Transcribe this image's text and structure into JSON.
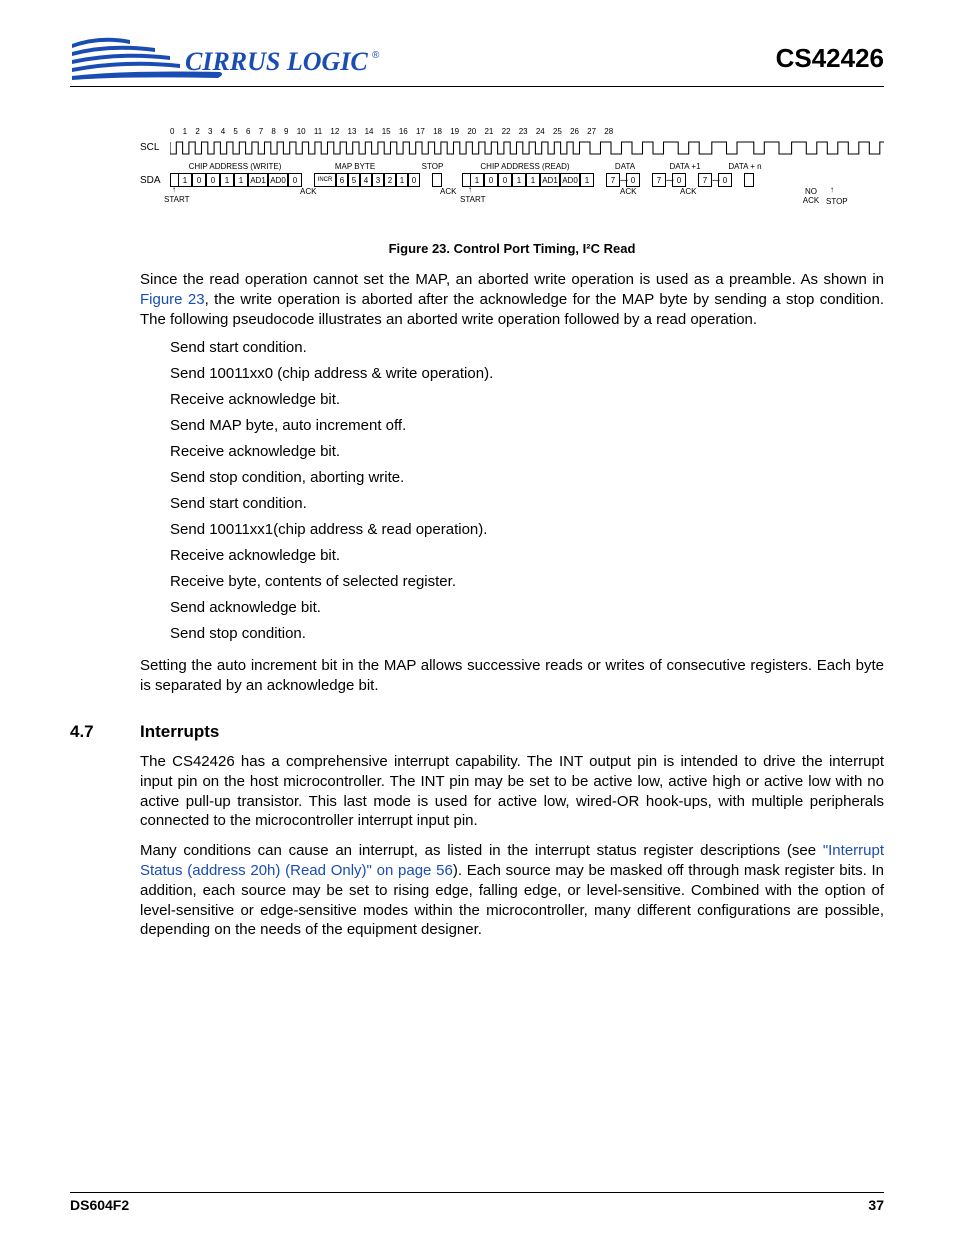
{
  "header": {
    "logo_text": "CIRRUS LOGIC",
    "part_number": "CS42426"
  },
  "figure": {
    "caption": "Figure 23.  Control Port Timing, I²C Read",
    "tick_numbers": "0  1  2  3  4  5  6  7  8  9  10 11 12 13 14 15 16 17 18  19  20 21 22 23 24 25 26 27 28",
    "scl_label": "SCL",
    "sda_label": "SDA",
    "top_labels": {
      "chip_addr_write": "CHIP ADDRESS (WRITE)",
      "map_byte": "MAP BYTE",
      "stop": "STOP",
      "chip_addr_read": "CHIP ADDRESS (READ)",
      "data": "DATA",
      "data_plus1": "DATA +1",
      "data_plusn": "DATA + n"
    },
    "sda_bits": {
      "addr_write": [
        "1",
        "0",
        "0",
        "1",
        "1",
        "AD1",
        "AD0",
        "0"
      ],
      "incr": "INCR",
      "map_bits": [
        "6",
        "5",
        "4",
        "3",
        "2",
        "1",
        "0"
      ],
      "addr_read": [
        "1",
        "0",
        "0",
        "1",
        "1",
        "AD1",
        "AD0",
        "1"
      ],
      "data_box": [
        "7",
        "0"
      ],
      "data1_box": [
        "7",
        "0"
      ],
      "datan_box": [
        "7",
        "0"
      ]
    },
    "bottom_labels": {
      "start1": "START",
      "ack1": "ACK",
      "ack2": "ACK",
      "start2": "START",
      "ack3": "ACK",
      "ack4": "ACK",
      "noack": "NO ACK",
      "stop2": "STOP"
    }
  },
  "para1_a": "Since the read operation cannot set the MAP, an aborted write operation is used as a preamble. As shown in ",
  "para1_link": "Figure 23",
  "para1_b": ", the write operation is aborted after the acknowledge for the MAP byte by sending a stop condition. The following pseudocode illustrates an aborted write operation followed by a read operation.",
  "pseudo": [
    "Send start condition.",
    "Send 10011xx0 (chip address & write operation).",
    "Receive acknowledge bit.",
    "Send MAP byte, auto increment off.",
    "Receive acknowledge bit.",
    "Send stop condition, aborting write.",
    "Send start condition.",
    "Send 10011xx1(chip address & read operation).",
    "Receive acknowledge bit.",
    "Receive byte, contents of selected register.",
    "Send acknowledge bit.",
    "Send stop condition."
  ],
  "para2": "Setting the auto increment bit in the MAP allows successive reads or writes of consecutive registers. Each byte is separated by an acknowledge bit.",
  "section": {
    "num": "4.7",
    "title": "Interrupts"
  },
  "para3": "The CS42426 has a comprehensive interrupt capability. The INT output pin is intended to drive the interrupt input pin on the host microcontroller. The INT pin may be set to be active low, active high or active low with no active pull-up transistor. This last mode is used for active low, wired-OR hook-ups, with multiple peripherals connected to the microcontroller interrupt input pin.",
  "para4_a": "Many conditions can cause an interrupt, as listed in the interrupt status register descriptions (see ",
  "para4_link": "\"Interrupt Status (address 20h) (Read Only)\" on page 56",
  "para4_b": "). Each source may be masked off through mask register bits. In addition, each source may be set to rising edge, falling edge, or level-sensitive. Combined with the option of level-sensitive or edge-sensitive modes within the microcontroller, many different configurations are possible, depending on the needs of the equipment designer.",
  "footer": {
    "left": "DS604F2",
    "right": "37"
  }
}
